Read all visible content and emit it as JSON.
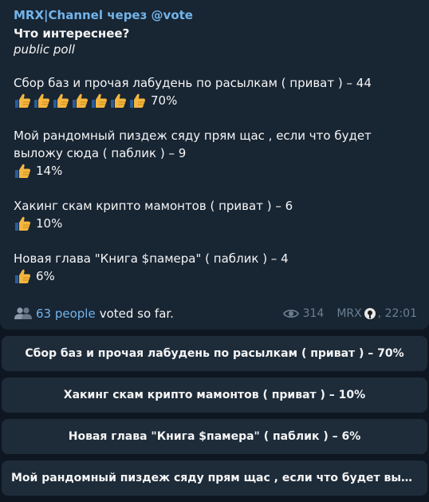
{
  "message": {
    "sender": "MRX|Channel через @vote",
    "question": "Что интереснее?",
    "poll_type": "public poll",
    "options": [
      {
        "text": "Сбор баз и прочая лабудень по расылкам ( приват ) – 44",
        "thumbs": 7,
        "percent": "70%"
      },
      {
        "text": "Мой рандомный пиздеж сяду прям щас , если что будет выложу сюда ( паблик ) – 9",
        "thumbs": 1,
        "percent": "14%"
      },
      {
        "text": "Хакинг скам крипто мамонтов ( приват ) – 6",
        "thumbs": 1,
        "percent": "10%"
      },
      {
        "text": "Новая глава \"Книга $памера\" ( паблик ) – 4",
        "thumbs": 1,
        "percent": "6%"
      }
    ],
    "voters_link": "63 people",
    "voters_suffix": "voted so far.",
    "views": "314",
    "author": "MRX",
    "time": ", 22:01"
  },
  "keyboard": [
    {
      "label": "Сбор баз и прочая лабудень по расылкам ( приват ) – 70%"
    },
    {
      "label": "Хакинг скам крипто мамонтов ( приват ) – 10%"
    },
    {
      "label": "Новая глава \"Книга $памера\" ( паблик ) – 6%"
    },
    {
      "label": "Мой рандомный пиздеж сяду прям щас , если что будет выл..."
    }
  ],
  "colors": {
    "background": "#0e1621",
    "bubble": "#182533",
    "accent": "#72b4ea",
    "button": "#1e2c3a",
    "meta": "#6d7f8f",
    "thumb": "#f4b63f"
  },
  "icons": {
    "thumb": "thumbs-up-icon",
    "people": "people-icon",
    "views": "eye-icon",
    "author_badge": "emoji-badge-icon"
  }
}
